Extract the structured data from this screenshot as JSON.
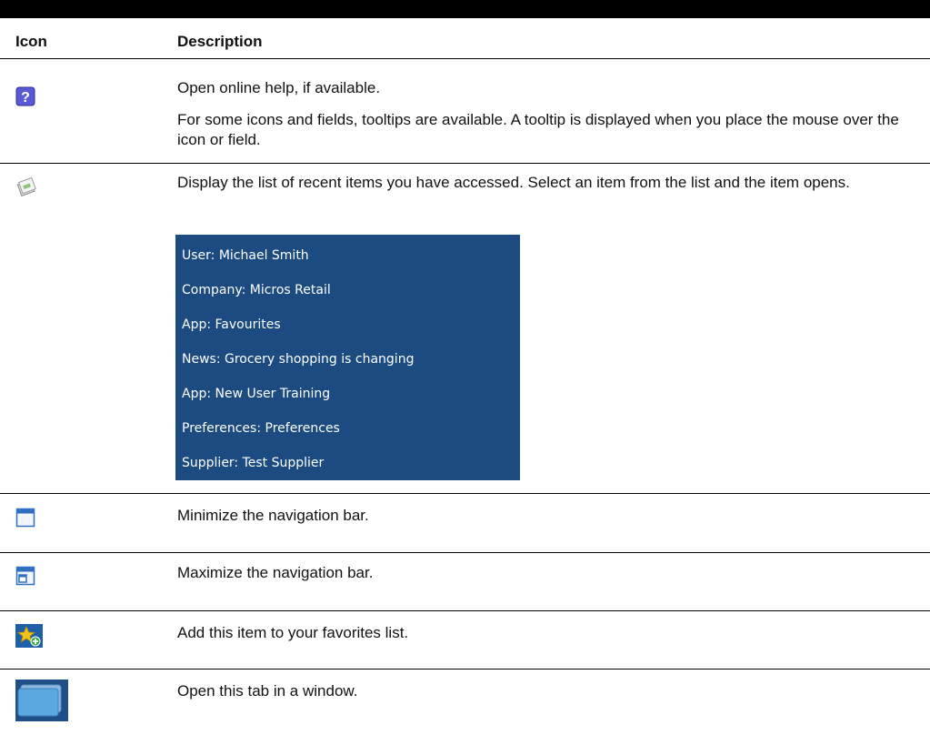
{
  "table": {
    "headers": {
      "icon": "Icon",
      "description": "Description"
    },
    "rows": [
      {
        "icon": "help-icon",
        "lines": [
          "Open online help, if available.",
          "For some icons and fields, tooltips are available. A tooltip is displayed when you place the mouse over the icon or field."
        ]
      },
      {
        "icon": "recent-items-icon",
        "lines": [
          "Display the list of recent items you have accessed. Select an item from the list and the item opens."
        ]
      },
      {
        "icon": "minimize-icon",
        "lines": [
          "Minimize the navigation bar."
        ]
      },
      {
        "icon": "maximize-icon",
        "lines": [
          "Maximize the navigation bar."
        ]
      },
      {
        "icon": "add-favorite-icon",
        "lines": [
          "Add this item to your favorites list."
        ]
      },
      {
        "icon": "open-in-window-icon",
        "lines": [
          "Open this tab in a window."
        ]
      }
    ]
  },
  "recent_items": [
    "User: Michael Smith",
    "Company: Micros Retail",
    "App: Favourites",
    "News: Grocery shopping is changing",
    "App: New User Training",
    "Preferences: Preferences",
    "Supplier: Test Supplier"
  ],
  "colors": {
    "list_background": "#1c4b82",
    "divider": "#000000",
    "icon_blue": "#2f6fbf"
  }
}
